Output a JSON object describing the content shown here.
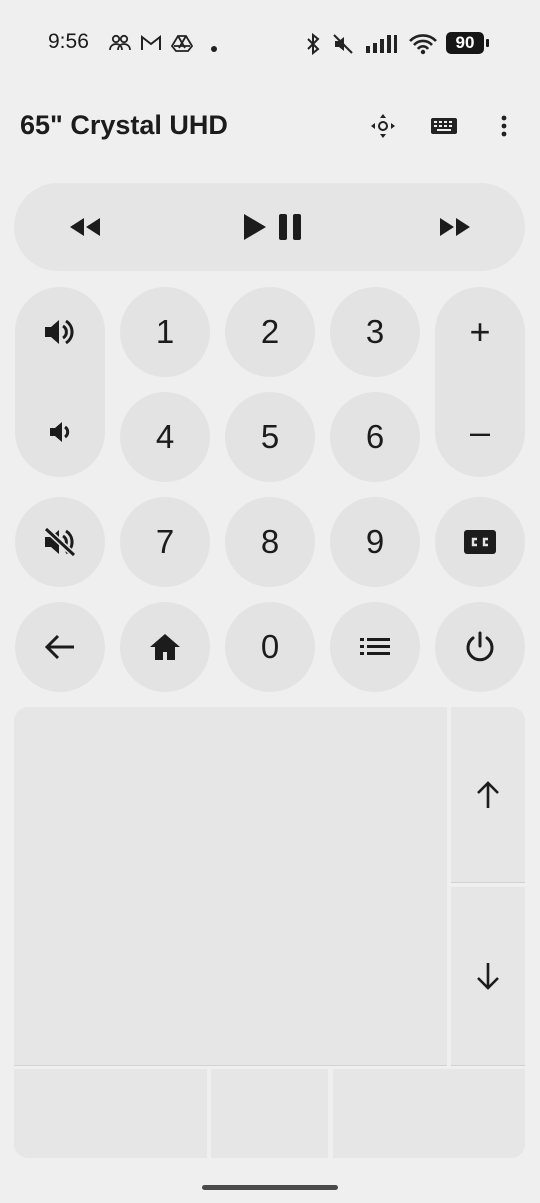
{
  "status_bar": {
    "time": "9:56",
    "battery": "90",
    "notification_icons": [
      "people-icon",
      "gmail-icon",
      "drive-icon",
      "dot-icon"
    ],
    "system_icons": [
      "bluetooth-icon",
      "mute-icon",
      "signal-icon",
      "wifi-icon",
      "battery-icon"
    ]
  },
  "header": {
    "title": "65\" Crystal UHD",
    "actions": [
      "dpad-icon",
      "keyboard-icon",
      "more-vert-icon"
    ]
  },
  "media_bar": {
    "buttons": [
      "rewind-icon",
      "play-pause-icon",
      "fast-forward-icon"
    ]
  },
  "keypad": {
    "digits": [
      "1",
      "2",
      "3",
      "4",
      "5",
      "6",
      "7",
      "8",
      "9",
      "0"
    ],
    "volume_icons": [
      "volume-up-icon",
      "volume-down-icon"
    ],
    "channel_labels": [
      "+",
      "–"
    ],
    "other_icons": [
      "mute-icon",
      "closed-caption-icon",
      "back-arrow-icon",
      "home-icon",
      "menu-list-icon",
      "power-icon"
    ]
  },
  "touchpad": {
    "scroll_icons": [
      "arrow-up-icon",
      "arrow-down-icon"
    ]
  },
  "colors": {
    "background": "#efefef",
    "button": "#e3e3e3",
    "text": "#1c1c1c"
  }
}
